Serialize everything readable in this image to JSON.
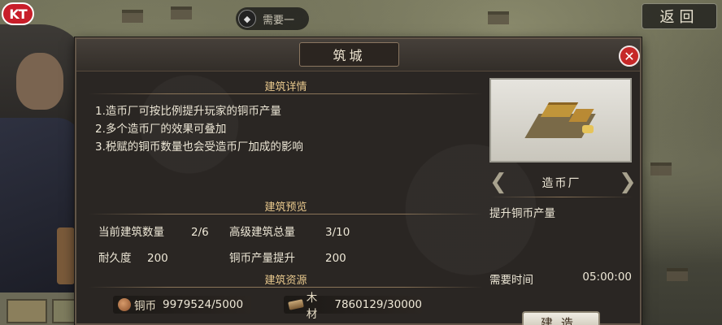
{
  "hud": {
    "logo_text": "KT",
    "player_name": "需要一",
    "back_label": "返回"
  },
  "dialog": {
    "title": "筑城",
    "close_glyph": "✕",
    "details": {
      "heading": "建筑详情",
      "lines": [
        "1.造币厂可按比例提升玩家的铜币产量",
        "2.多个造币厂的效果可叠加",
        "3.税赋的铜币数量也会受造币厂加成的影响"
      ]
    },
    "preview": {
      "heading": "建筑预览",
      "current_count_label": "当前建筑数量",
      "current_count_value": "2/6",
      "advanced_total_label": "高级建筑总量",
      "advanced_total_value": "3/10",
      "durability_label": "耐久度",
      "durability_value": "200",
      "copper_boost_label": "铜币产量提升",
      "copper_boost_value": "200"
    },
    "resources": {
      "heading": "建筑资源",
      "copper_label": "铜币",
      "copper_value": "9979524/5000",
      "wood_label": "木材",
      "wood_value": "7860129/30000"
    },
    "building": {
      "name": "造币厂",
      "description": "提升铜币产量",
      "time_label": "需要时间",
      "time_value": "05:00:00",
      "build_label": "建造",
      "prev_arrow": "❮",
      "next_arrow": "❯"
    }
  },
  "colors": {
    "accent_gold": "#e9c98e",
    "close_red": "#c62828",
    "panel_bg": "#2a2623"
  }
}
